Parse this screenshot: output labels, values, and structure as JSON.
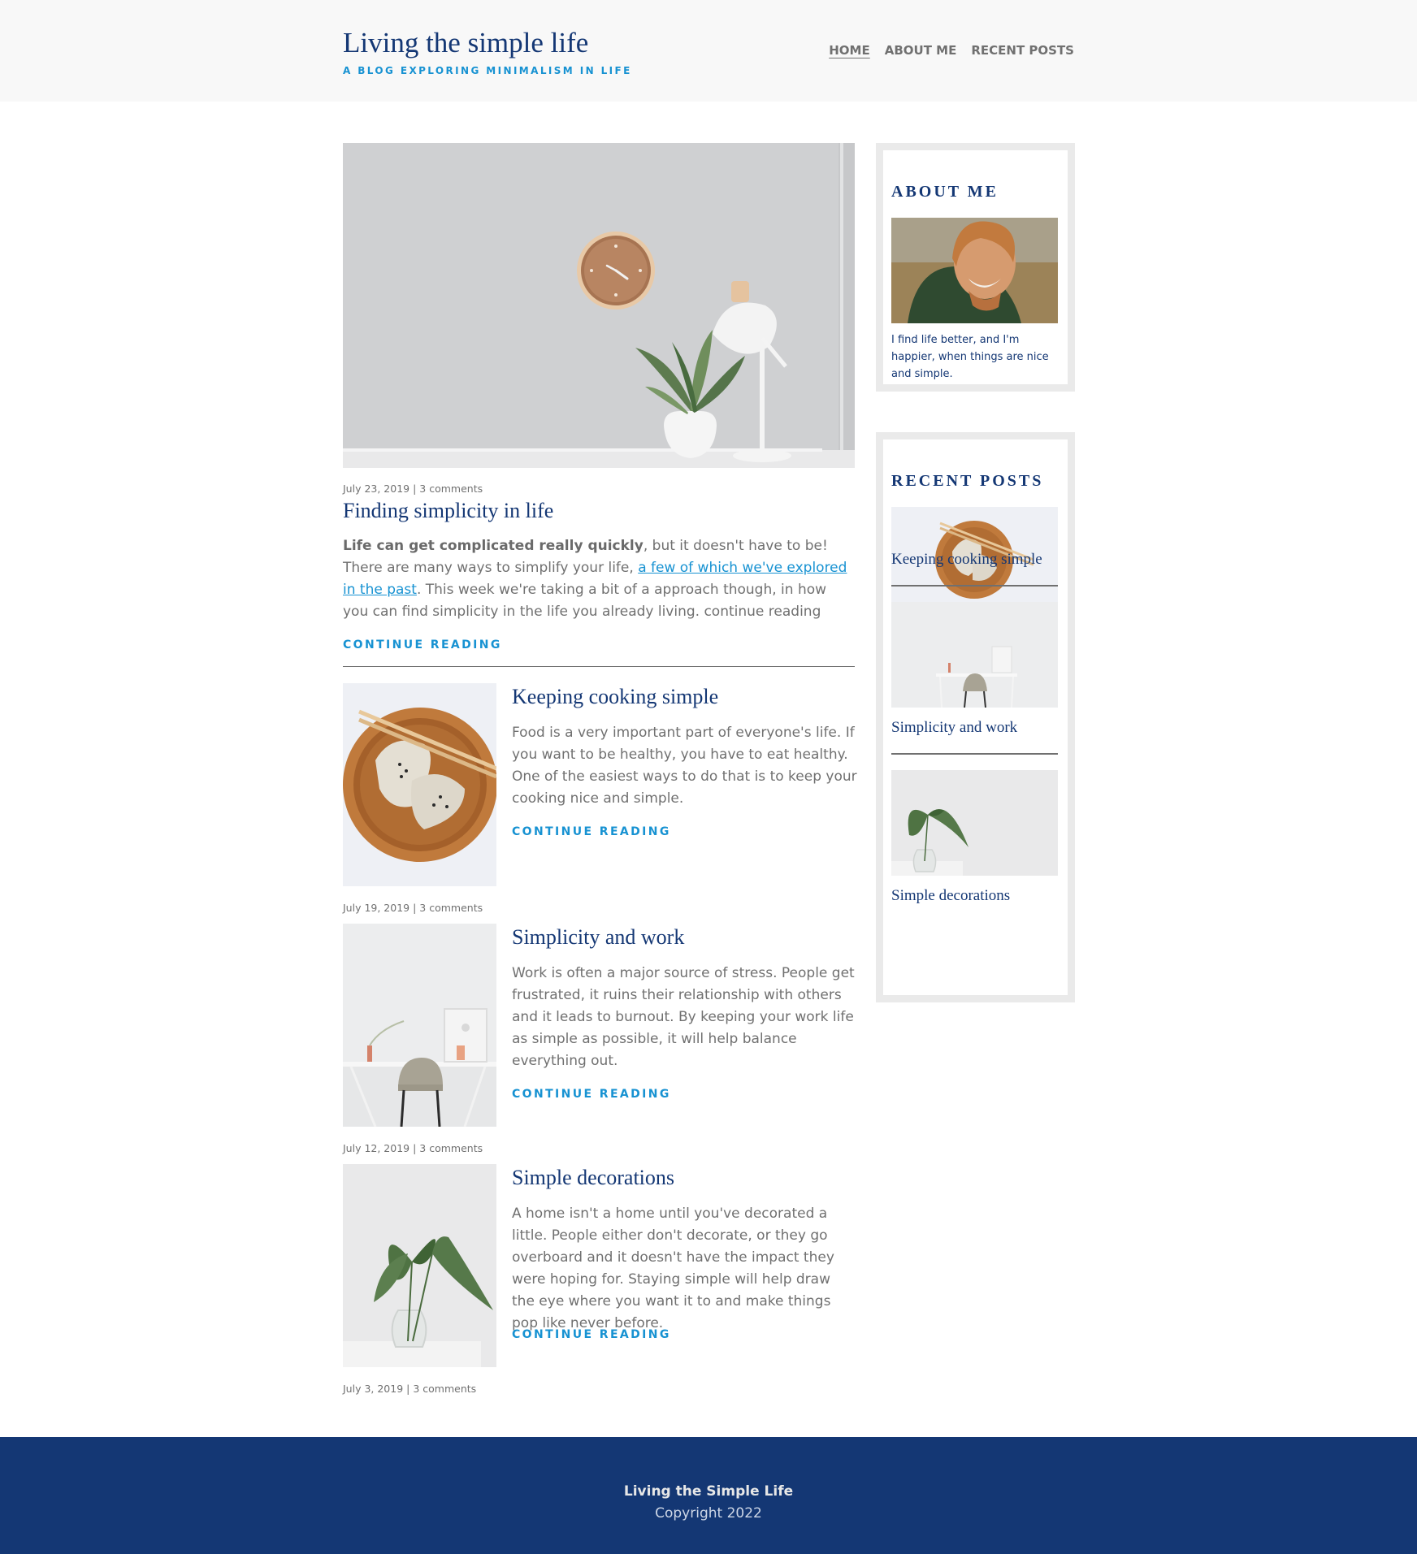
{
  "header": {
    "title": "Living the simple life",
    "tagline": "A BLOG EXPLORING MINIMALISM IN LIFE",
    "nav": [
      {
        "label": "HOME",
        "active": true
      },
      {
        "label": "ABOUT ME",
        "active": false
      },
      {
        "label": "RECENT POSTS",
        "active": false
      }
    ]
  },
  "featured": {
    "meta_date": "July 23, 2019",
    "meta_comments": "3 comments",
    "title": "Finding simplicity in life",
    "excerpt_bold": "Life can get complicated really quickly",
    "excerpt_part1": ", but it doesn't have to be! There are many ways to simplify your life, ",
    "excerpt_link": "a few of which we've explored in the past",
    "excerpt_part2": ". This week we're taking a bit of a approach though, in how you can find simplicity in the life you already living. continue reading",
    "read_more": "CONTINUE READING"
  },
  "posts": [
    {
      "title": "Keeping cooking simple",
      "excerpt": "Food is a very important part of everyone's life. If you want to be healthy, you have to eat healthy. One of the easiest ways to do that is to keep your cooking nice and simple.",
      "read_more": "CONTINUE READING",
      "meta_date": "July 19, 2019",
      "meta_comments": "3 comments"
    },
    {
      "title": "Simplicity and work",
      "excerpt": "Work is often a major source of stress. People get frustrated, it ruins their relationship with others and it leads to burnout. By keeping your work life as simple as possible, it will help balance everything out.",
      "read_more": "CONTINUE READING",
      "meta_date": "July 12, 2019",
      "meta_comments": "3 comments"
    },
    {
      "title": "Simple decorations",
      "excerpt": "A home isn't a home until you've decorated a little. People either don't decorate, or they go overboard and it doesn't have the impact they were hoping for. Staying simple will help draw the eye where you want it to and make things pop like never before.",
      "read_more": "CONTINUE READING",
      "meta_date": "July 3, 2019",
      "meta_comments": "3 comments"
    }
  ],
  "sidebar": {
    "about": {
      "title": "ABOUT ME",
      "text": "I find life better, and I'm happier, when things are nice and simple."
    },
    "recent": {
      "title": "RECENT POSTS",
      "items": [
        {
          "title": "Keeping cooking simple"
        },
        {
          "title": "Simplicity and work"
        },
        {
          "title": "Simple decorations"
        }
      ]
    }
  },
  "footer": {
    "name": "Living the Simple Life",
    "copyright": "Copyright 2022"
  },
  "colors": {
    "navy": "#143774",
    "accent": "#1792d2",
    "text": "#707070",
    "header_bg": "#f8f8f8",
    "widget_border": "#eaeaea"
  }
}
